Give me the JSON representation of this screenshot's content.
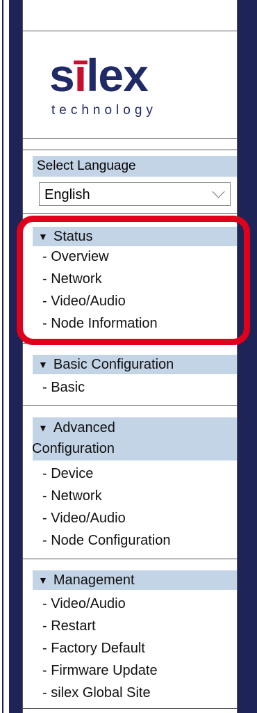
{
  "logo": {
    "brand_pre": "s",
    "brand_accent": "ī",
    "brand_post": "lex",
    "tagline": "technology"
  },
  "language": {
    "label": "Select Language",
    "selected": "English"
  },
  "sections": {
    "status": {
      "title": "Status",
      "items": [
        "- Overview",
        "- Network",
        "- Video/Audio",
        "- Node Information"
      ]
    },
    "basic": {
      "title": "Basic Configuration",
      "items": [
        "- Basic"
      ]
    },
    "advanced": {
      "title_line1": "Advanced",
      "title_line2": "Configuration",
      "items": [
        "- Device",
        "- Network",
        "- Video/Audio",
        "- Node Configuration"
      ]
    },
    "management": {
      "title": "Management",
      "items": [
        "- Video/Audio",
        "- Restart",
        "- Factory Default",
        "- Firmware Update",
        "- silex Global Site"
      ]
    }
  },
  "icons": {
    "section_toggle": "triangle-down-icon",
    "dropdown": "chevron-down-icon"
  },
  "colors": {
    "sidebar_bg": "#1e2358",
    "header_bg": "#c4d4e7",
    "highlight": "#e0001b",
    "brand": "#1f2a66",
    "brand_accent": "#c8102e"
  }
}
